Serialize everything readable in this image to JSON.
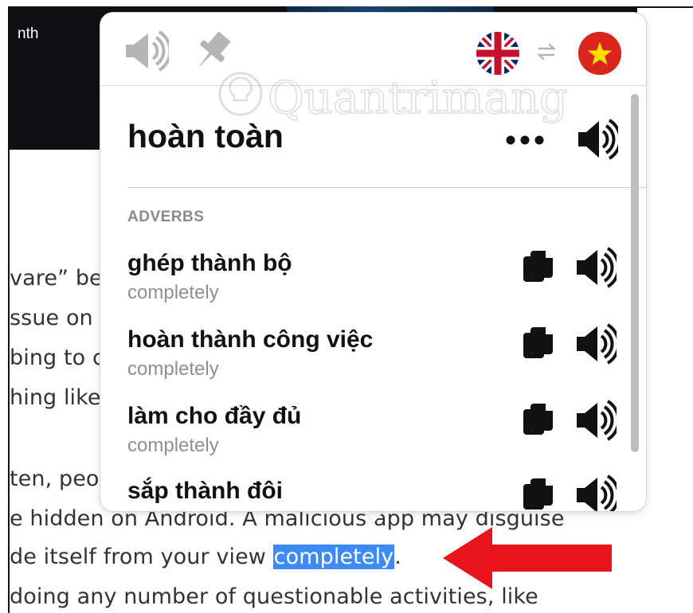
{
  "article": {
    "banner_text": "nth",
    "lines": [
      "vare” be",
      "ssue on",
      "bing to c",
      "hing like",
      "ten, peo",
      "e hidden on Android. A malicious app may disguise",
      "de itself from your view ",
      " doing any number of questionable activities, like"
    ],
    "highlighted_word": "completely",
    "after_highlight": "."
  },
  "popup": {
    "header": {
      "speaker_icon": "speaker-icon",
      "pin_icon": "pin-icon",
      "source_flag": "uk-flag",
      "swap_icon": "swap-icon",
      "target_flag": "vietnam-flag"
    },
    "watermark": "Quantrimang",
    "main_word": "hoàn toàn",
    "section_label": "ADVERBS",
    "entries": [
      {
        "word": "ghép thành bộ",
        "sub": "completely"
      },
      {
        "word": "hoàn thành công việc",
        "sub": "completely"
      },
      {
        "word": "làm cho đầy đủ",
        "sub": "completely"
      },
      {
        "word": "sắp thành đôi",
        "sub": ""
      }
    ]
  },
  "colors": {
    "highlight": "#3d8af7",
    "arrow": "#e8141b",
    "vn_red": "#da251d",
    "vn_star": "#ffde00"
  }
}
